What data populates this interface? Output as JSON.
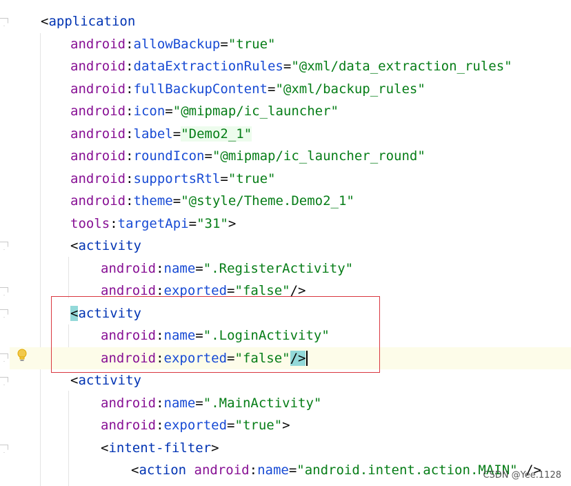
{
  "editor": {
    "lines": [
      {
        "indent": 0,
        "tokens": [
          {
            "t": "<",
            "c": "pun"
          },
          {
            "t": "application",
            "c": "tag"
          }
        ]
      },
      {
        "indent": 1,
        "tokens": [
          {
            "t": "android",
            "c": "ns"
          },
          {
            "t": ":",
            "c": "pun"
          },
          {
            "t": "allowBackup",
            "c": "attr"
          },
          {
            "t": "=",
            "c": "pun"
          },
          {
            "t": "\"true\"",
            "c": "val"
          }
        ]
      },
      {
        "indent": 1,
        "tokens": [
          {
            "t": "android",
            "c": "ns"
          },
          {
            "t": ":",
            "c": "pun"
          },
          {
            "t": "dataExtractionRules",
            "c": "attr"
          },
          {
            "t": "=",
            "c": "pun"
          },
          {
            "t": "\"@xml/data_extraction_rules\"",
            "c": "val"
          }
        ]
      },
      {
        "indent": 1,
        "tokens": [
          {
            "t": "android",
            "c": "ns"
          },
          {
            "t": ":",
            "c": "pun"
          },
          {
            "t": "fullBackupContent",
            "c": "attr"
          },
          {
            "t": "=",
            "c": "pun"
          },
          {
            "t": "\"@xml/backup_rules\"",
            "c": "val"
          }
        ]
      },
      {
        "indent": 1,
        "tokens": [
          {
            "t": "android",
            "c": "ns"
          },
          {
            "t": ":",
            "c": "pun"
          },
          {
            "t": "icon",
            "c": "attr"
          },
          {
            "t": "=",
            "c": "pun"
          },
          {
            "t": "\"@mipmap/ic_launcher\"",
            "c": "val"
          }
        ]
      },
      {
        "indent": 1,
        "tokens": [
          {
            "t": "android",
            "c": "ns"
          },
          {
            "t": ":",
            "c": "pun"
          },
          {
            "t": "label",
            "c": "attr"
          },
          {
            "t": "=",
            "c": "pun"
          },
          {
            "t": "\"Demo2_1\"",
            "c": "val hl-val"
          }
        ]
      },
      {
        "indent": 1,
        "tokens": [
          {
            "t": "android",
            "c": "ns"
          },
          {
            "t": ":",
            "c": "pun"
          },
          {
            "t": "roundIcon",
            "c": "attr"
          },
          {
            "t": "=",
            "c": "pun"
          },
          {
            "t": "\"@mipmap/ic_launcher_round\"",
            "c": "val"
          }
        ]
      },
      {
        "indent": 1,
        "tokens": [
          {
            "t": "android",
            "c": "ns"
          },
          {
            "t": ":",
            "c": "pun"
          },
          {
            "t": "supportsRtl",
            "c": "attr"
          },
          {
            "t": "=",
            "c": "pun"
          },
          {
            "t": "\"true\"",
            "c": "val"
          }
        ]
      },
      {
        "indent": 1,
        "tokens": [
          {
            "t": "android",
            "c": "ns"
          },
          {
            "t": ":",
            "c": "pun"
          },
          {
            "t": "theme",
            "c": "attr"
          },
          {
            "t": "=",
            "c": "pun"
          },
          {
            "t": "\"@style/Theme.Demo2_1\"",
            "c": "val"
          }
        ]
      },
      {
        "indent": 1,
        "tokens": [
          {
            "t": "tools",
            "c": "ns"
          },
          {
            "t": ":",
            "c": "pun"
          },
          {
            "t": "targetApi",
            "c": "attr"
          },
          {
            "t": "=",
            "c": "pun"
          },
          {
            "t": "\"31\"",
            "c": "val"
          },
          {
            "t": ">",
            "c": "pun"
          }
        ]
      },
      {
        "indent": 1,
        "tokens": [
          {
            "t": "<",
            "c": "pun"
          },
          {
            "t": "activity",
            "c": "tag"
          }
        ]
      },
      {
        "indent": 2,
        "tokens": [
          {
            "t": "android",
            "c": "ns"
          },
          {
            "t": ":",
            "c": "pun"
          },
          {
            "t": "name",
            "c": "attr"
          },
          {
            "t": "=",
            "c": "pun"
          },
          {
            "t": "\".RegisterActivity\"",
            "c": "val"
          }
        ]
      },
      {
        "indent": 2,
        "tokens": [
          {
            "t": "android",
            "c": "ns"
          },
          {
            "t": ":",
            "c": "pun"
          },
          {
            "t": "exported",
            "c": "attr"
          },
          {
            "t": "=",
            "c": "pun"
          },
          {
            "t": "\"false\"",
            "c": "val"
          },
          {
            "t": "/>",
            "c": "pun"
          }
        ]
      },
      {
        "indent": 1,
        "tokens": [
          {
            "t": "<",
            "c": "pun hl-br"
          },
          {
            "t": "activity",
            "c": "tag"
          }
        ]
      },
      {
        "indent": 2,
        "tokens": [
          {
            "t": "android",
            "c": "ns"
          },
          {
            "t": ":",
            "c": "pun"
          },
          {
            "t": "name",
            "c": "attr"
          },
          {
            "t": "=",
            "c": "pun"
          },
          {
            "t": "\".LoginActivity\"",
            "c": "val"
          }
        ]
      },
      {
        "indent": 2,
        "caret": true,
        "tokens": [
          {
            "t": "android",
            "c": "ns"
          },
          {
            "t": ":",
            "c": "pun"
          },
          {
            "t": "exported",
            "c": "attr"
          },
          {
            "t": "=",
            "c": "pun"
          },
          {
            "t": "\"false\"",
            "c": "val"
          },
          {
            "t": "/>",
            "c": "pun hl-br"
          }
        ]
      },
      {
        "indent": 1,
        "tokens": [
          {
            "t": "<",
            "c": "pun"
          },
          {
            "t": "activity",
            "c": "tag"
          }
        ]
      },
      {
        "indent": 2,
        "tokens": [
          {
            "t": "android",
            "c": "ns"
          },
          {
            "t": ":",
            "c": "pun"
          },
          {
            "t": "name",
            "c": "attr"
          },
          {
            "t": "=",
            "c": "pun"
          },
          {
            "t": "\".MainActivity\"",
            "c": "val"
          }
        ]
      },
      {
        "indent": 2,
        "tokens": [
          {
            "t": "android",
            "c": "ns"
          },
          {
            "t": ":",
            "c": "pun"
          },
          {
            "t": "exported",
            "c": "attr"
          },
          {
            "t": "=",
            "c": "pun"
          },
          {
            "t": "\"true\"",
            "c": "val"
          },
          {
            "t": ">",
            "c": "pun"
          }
        ]
      },
      {
        "indent": 2,
        "tokens": [
          {
            "t": "<",
            "c": "pun"
          },
          {
            "t": "intent-filter",
            "c": "tag"
          },
          {
            "t": ">",
            "c": "pun"
          }
        ]
      },
      {
        "indent": 3,
        "tokens": [
          {
            "t": "<",
            "c": "pun"
          },
          {
            "t": "action ",
            "c": "tag"
          },
          {
            "t": "android",
            "c": "ns"
          },
          {
            "t": ":",
            "c": "pun"
          },
          {
            "t": "name",
            "c": "attr"
          },
          {
            "t": "=",
            "c": "pun"
          },
          {
            "t": "\"android.intent.action.MAIN\"",
            "c": "val"
          },
          {
            "t": " />",
            "c": "pun"
          }
        ]
      }
    ]
  },
  "colors": {
    "tag": "#0033b3",
    "namespace": "#871094",
    "attribute": "#174ad4",
    "value": "#067d17",
    "highlight_box": "#d9363e",
    "caret_line": "#fdfce9"
  },
  "icons": {
    "intention": "lightbulb-icon",
    "fold": "fold-marker-icon"
  },
  "watermark": "CSDN @Yee.1128"
}
